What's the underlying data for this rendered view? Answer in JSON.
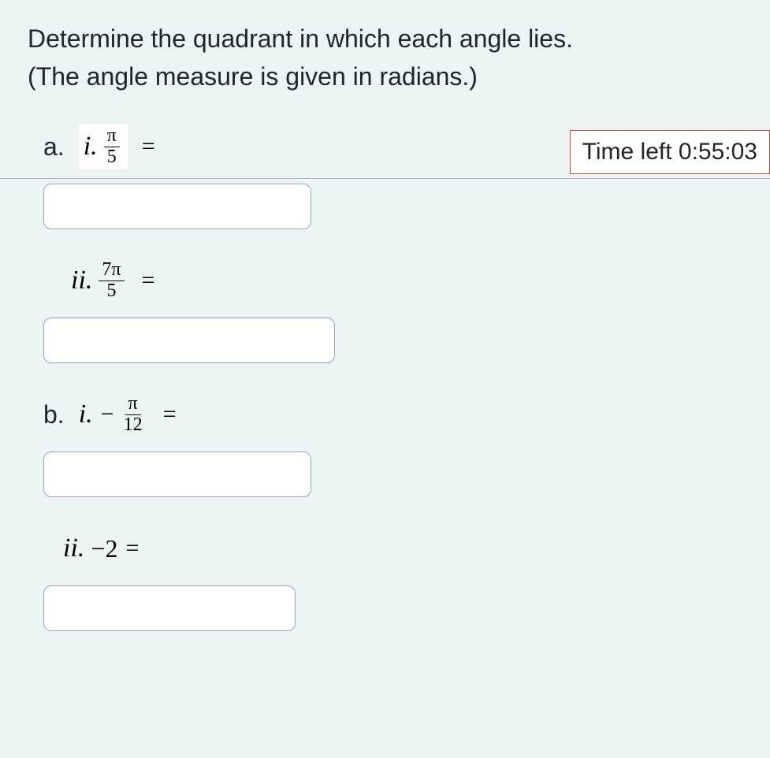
{
  "instructions": {
    "line1": "Determine the quadrant in which each angle lies.",
    "line2": "(The angle measure is given in radians.)"
  },
  "timer": {
    "label": "Time left 0:55:03"
  },
  "parts": {
    "a": {
      "letter": "a.",
      "items": {
        "i": {
          "roman": "i.",
          "frac_num": "π",
          "frac_den": "5",
          "equals": "=",
          "value": ""
        },
        "ii": {
          "roman": "ii.",
          "frac_num": "7π",
          "frac_den": "5",
          "equals": "=",
          "value": ""
        }
      }
    },
    "b": {
      "letter": "b.",
      "items": {
        "i": {
          "roman": "i.",
          "neg": "−",
          "frac_num": "π",
          "frac_den": "12",
          "equals": "=",
          "value": ""
        },
        "ii": {
          "roman": "ii.",
          "expr": "−2",
          "equals": "=",
          "value": ""
        }
      }
    }
  }
}
